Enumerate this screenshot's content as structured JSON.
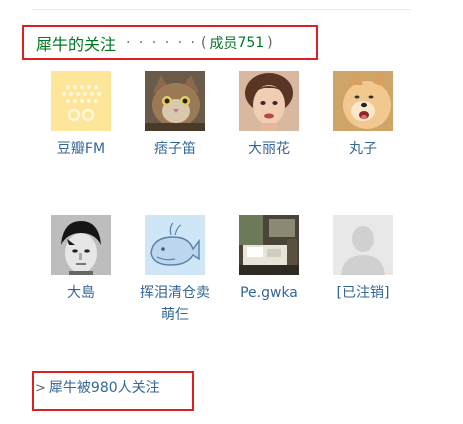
{
  "group": {
    "title": "犀牛的关注",
    "dots": "· · · · · ·",
    "member_label": "成员",
    "member_count": "751"
  },
  "members": [
    {
      "name": "豆瓣FM",
      "icon": "douban-fm-avatar"
    },
    {
      "name": "痞子笛",
      "icon": "cat-avatar"
    },
    {
      "name": "大丽花",
      "icon": "vintage-woman-avatar"
    },
    {
      "name": "丸子",
      "icon": "dog-avatar"
    },
    {
      "name": "大島",
      "icon": "boy-portrait-avatar"
    },
    {
      "name": "挥泪清仓卖萌仨",
      "icon": "whale-avatar"
    },
    {
      "name": "Pe.gwka",
      "icon": "room-photo-avatar"
    },
    {
      "name": "[已注销]",
      "icon": "default-user-avatar"
    }
  ],
  "followers": {
    "arrow": ">",
    "text": "犀牛被980人关注"
  }
}
